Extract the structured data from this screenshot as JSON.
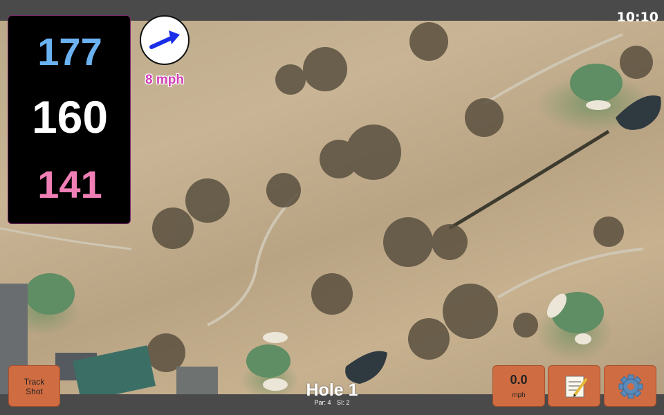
{
  "status": {
    "time": "10:10"
  },
  "distances": {
    "back": "177",
    "center": "160",
    "front": "141"
  },
  "wind": {
    "speed": "8 mph",
    "icon": "wind-direction-arrow-icon"
  },
  "hole": {
    "title": "Hole 1",
    "par": "Par: 4",
    "stroke_index": "SI: 2"
  },
  "buttons": {
    "track_shot_line1": "Track",
    "track_shot_line2": "Shot",
    "speed_value": "0.0",
    "speed_unit": "mph",
    "notes_icon": "notepad-icon",
    "settings_icon": "gear-icon"
  },
  "colors": {
    "back_distance": "#6bb2f2",
    "center_distance": "#ffffff",
    "front_distance": "#f07fb5",
    "wind_text": "#d23fb8",
    "button": "#d06c42",
    "bar": "#4a4a4a"
  }
}
